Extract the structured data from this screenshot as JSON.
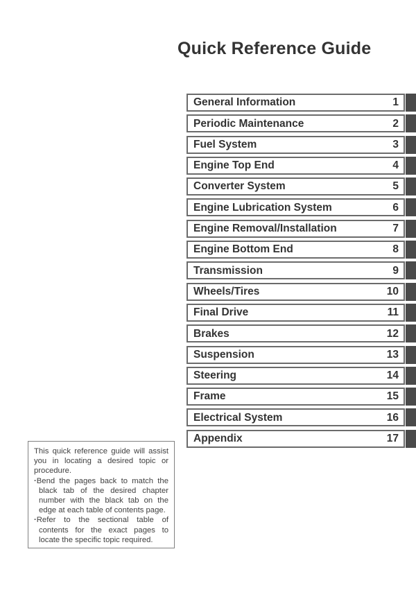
{
  "document": {
    "title": "Quick Reference Guide"
  },
  "chapter_table": {
    "rows": [
      {
        "name": "General Information",
        "number": "1"
      },
      {
        "name": "Periodic Maintenance",
        "number": "2"
      },
      {
        "name": "Fuel System",
        "number": "3"
      },
      {
        "name": "Engine Top End",
        "number": "4"
      },
      {
        "name": "Converter System",
        "number": "5"
      },
      {
        "name": "Engine Lubrication System",
        "number": "6"
      },
      {
        "name": "Engine Removal/Installation",
        "number": "7"
      },
      {
        "name": "Engine Bottom End",
        "number": "8"
      },
      {
        "name": "Transmission",
        "number": "9"
      },
      {
        "name": "Wheels/Tires",
        "number": "10"
      },
      {
        "name": "Final Drive",
        "number": "11"
      },
      {
        "name": "Brakes",
        "number": "12"
      },
      {
        "name": "Suspension",
        "number": "13"
      },
      {
        "name": "Steering",
        "number": "14"
      },
      {
        "name": "Frame",
        "number": "15"
      },
      {
        "name": "Electrical System",
        "number": "16"
      },
      {
        "name": "Appendix",
        "number": "17"
      }
    ]
  },
  "note": {
    "intro": "This quick reference guide will assist you in locating a desired topic or procedure.",
    "bullets": [
      "Bend the pages back to match the black tab of the desired chapter number with the black tab on the edge at each table of contents page.",
      "Refer to the sectional table of contents for the exact pages to locate the specific topic required."
    ],
    "bullet_glyph": "·"
  },
  "colors": {
    "tab": "#4a4a4a",
    "box_border": "#6b6b6b",
    "text": "#333333",
    "page_background": "#ffffff"
  }
}
